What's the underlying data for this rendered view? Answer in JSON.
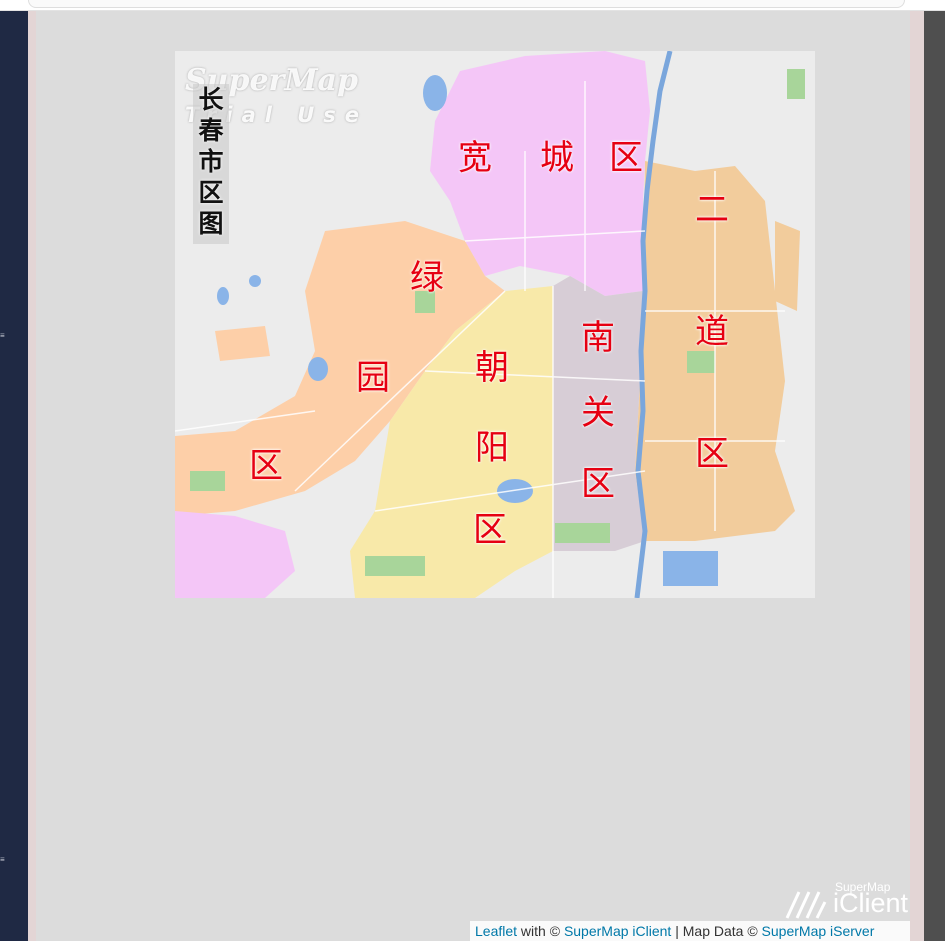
{
  "map": {
    "title_chars": [
      "长",
      "春",
      "市",
      "区",
      "图"
    ],
    "watermark": "SuperMap",
    "watermark_sub": "Trial Use",
    "districts": {
      "kuancheng": [
        "宽",
        "城",
        "区"
      ],
      "erdao": [
        "二",
        "道",
        "区"
      ],
      "lvyuan": [
        "绿",
        "园",
        "区"
      ],
      "chaoyang": [
        "朝",
        "阳",
        "区"
      ],
      "nanguan": [
        "南",
        "关",
        "区"
      ]
    },
    "colors": {
      "kuancheng": "#f4c6f7",
      "erdao": "#f2cc9c",
      "lvyuan": "#fdcfa8",
      "chaoyang": "#f8e9a9",
      "nanguan": "#d7cdd6",
      "water": "#8ab4e8",
      "green": "#a8d59a",
      "background": "#ececec",
      "label": "#e60012"
    }
  },
  "brand": {
    "small": "SuperMap",
    "main": "iClient"
  },
  "attribution": {
    "leaflet": "Leaflet",
    "with": " with © ",
    "iclient": "SuperMap iClient",
    "sep": " | Map Data © ",
    "iserver": "SuperMap iServer"
  }
}
